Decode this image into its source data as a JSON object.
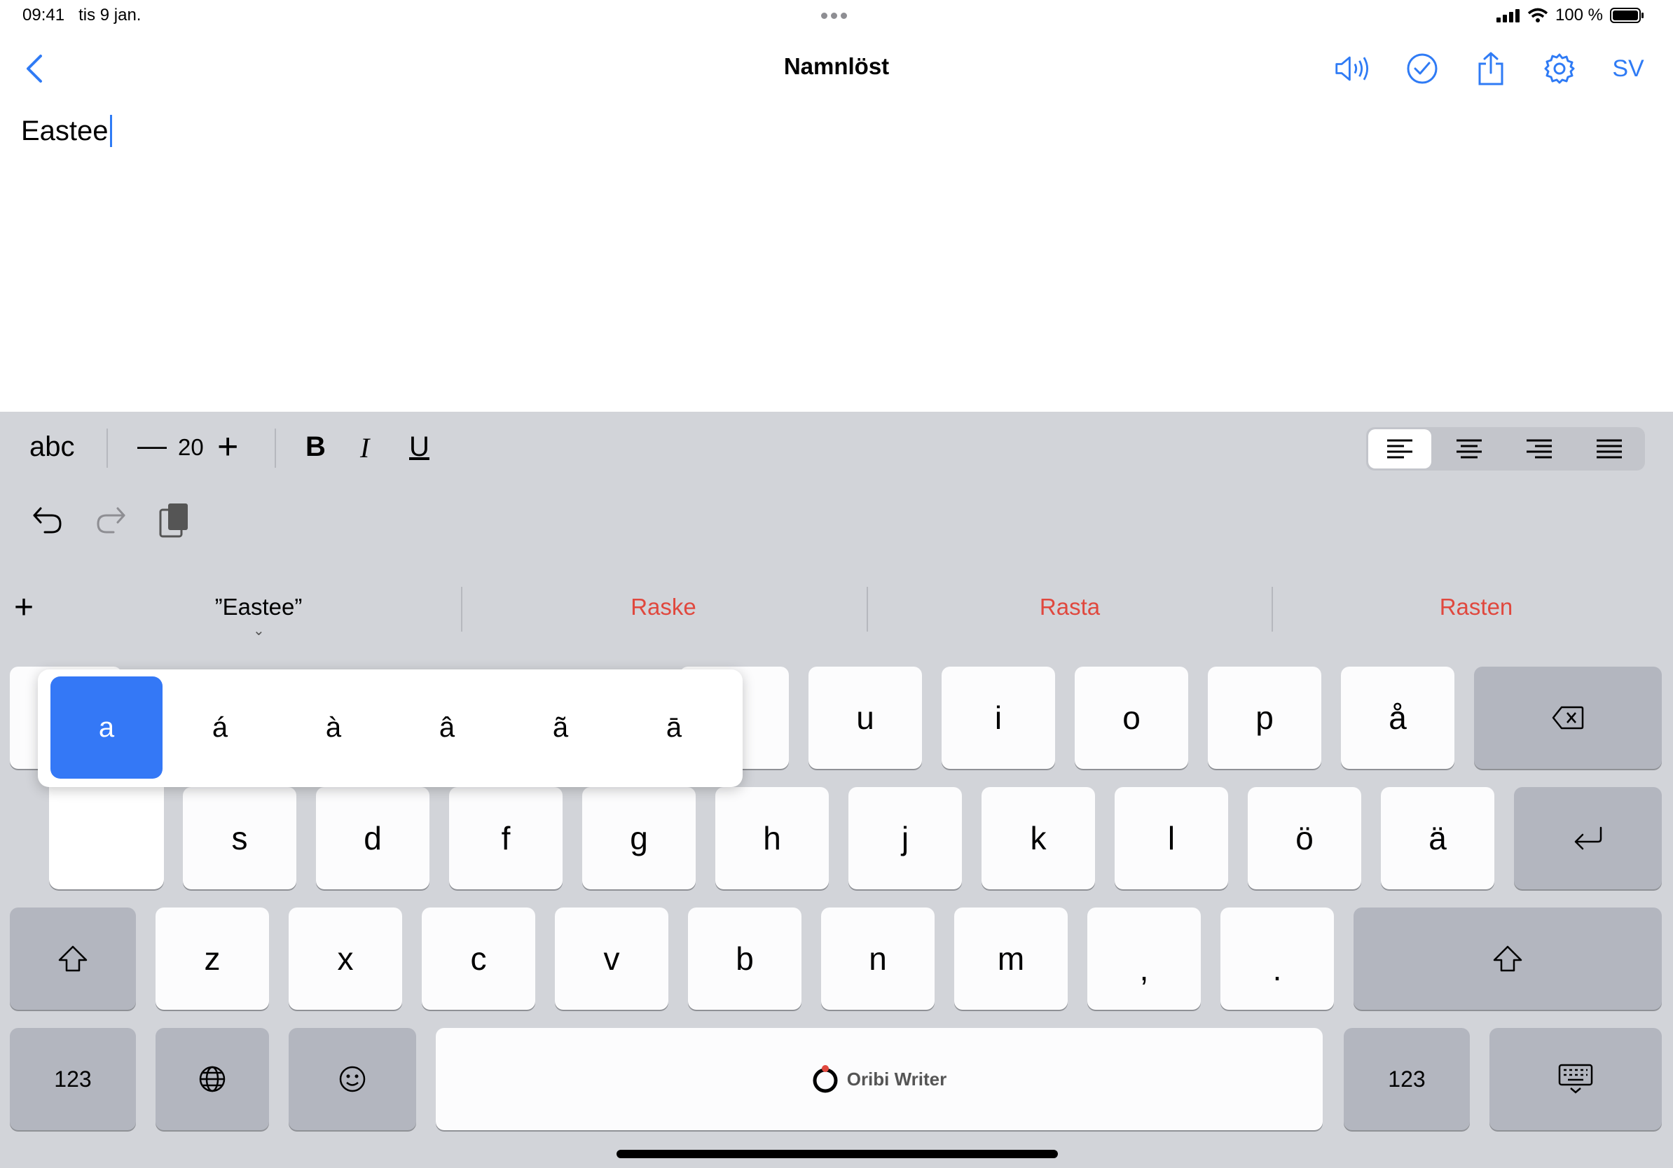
{
  "status_bar": {
    "time": "09:41",
    "date": "tis 9 jan.",
    "battery": "100 %"
  },
  "nav": {
    "title": "Namnlöst",
    "language": "SV"
  },
  "document": {
    "text": "Eastee"
  },
  "format_bar": {
    "mode": "abc",
    "font_size": "20",
    "bold": "B",
    "italic": "I",
    "underline": "U",
    "minus": "—",
    "plus": "+"
  },
  "suggestions": {
    "add": "+",
    "typed": "”Eastee”",
    "items": [
      "Raske",
      "Rasta",
      "Rasten"
    ]
  },
  "accent_popup": {
    "options": [
      "a",
      "á",
      "à",
      "â",
      "ã",
      "ā"
    ],
    "selected": "a"
  },
  "keys": {
    "row1": [
      "u",
      "i",
      "o",
      "p",
      "å"
    ],
    "row2": [
      "s",
      "d",
      "f",
      "g",
      "h",
      "j",
      "k",
      "l",
      "ö",
      "ä"
    ],
    "row3": [
      "z",
      "x",
      "c",
      "v",
      "b",
      "n",
      "m",
      ",",
      "."
    ],
    "numbers": "123",
    "numbers_right": "123",
    "space": "Oribi Writer"
  },
  "colors": {
    "accent": "#2f7bf5",
    "suggestion": "#e0483e",
    "keyboard_bg": "#d2d4d9"
  }
}
